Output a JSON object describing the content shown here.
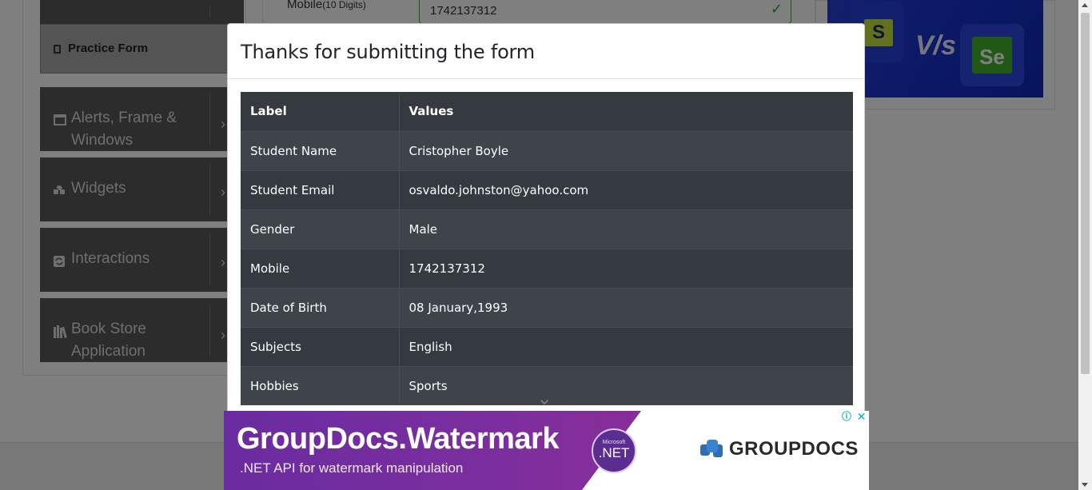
{
  "sidebar": {
    "practice_form": "Practice Form",
    "items": [
      {
        "label": "Alerts, Frame & Windows"
      },
      {
        "label": "Widgets"
      },
      {
        "label": "Interactions"
      },
      {
        "label": "Book Store Application"
      }
    ]
  },
  "form": {
    "mobile_label": "Mobile",
    "mobile_hint": "(10 Digits)",
    "mobile_value": "1742137312"
  },
  "modal": {
    "title": "Thanks for submitting the form",
    "columns": [
      "Label",
      "Values"
    ],
    "rows": [
      {
        "label": "Student Name",
        "value": "Cristopher Boyle"
      },
      {
        "label": "Student Email",
        "value": "osvaldo.johnston@yahoo.com"
      },
      {
        "label": "Gender",
        "value": "Male"
      },
      {
        "label": "Mobile",
        "value": "1742137312"
      },
      {
        "label": "Date of Birth",
        "value": "08 January,1993"
      },
      {
        "label": "Subjects",
        "value": "English"
      },
      {
        "label": "Hobbies",
        "value": "Sports"
      }
    ]
  },
  "ad": {
    "title": "GroupDocs.Watermark",
    "subtitle": ".NET API for watermark manipulation",
    "badge_small": "Microsoft",
    "badge": ".NET",
    "brand": "GROUPDOCS"
  },
  "banner": {
    "left_letter": "S",
    "vs": "V/s",
    "right_letter": "Se"
  },
  "colors": {
    "overlay": "#000000",
    "table_dark": "#343a40",
    "success": "#28a745",
    "ad_purple": "#7b2e9e"
  }
}
